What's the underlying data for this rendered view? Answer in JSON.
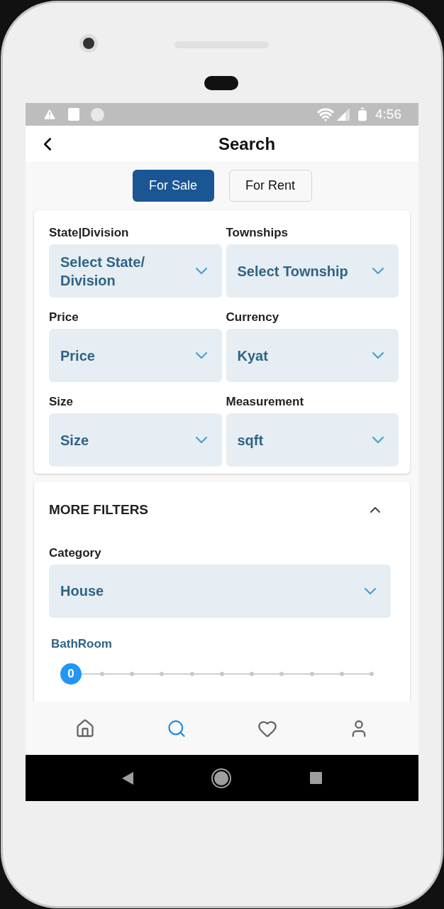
{
  "status_bar": {
    "time": "4:56"
  },
  "header": {
    "title": "Search"
  },
  "listing_tabs": [
    {
      "label": "For Sale",
      "selected": true
    },
    {
      "label": "For Rent",
      "selected": false
    }
  ],
  "filters": [
    {
      "label": "State|Division",
      "value": "Select State/ Division"
    },
    {
      "label": "Townships",
      "value": "Select Township"
    },
    {
      "label": "Price",
      "value": "Price"
    },
    {
      "label": "Currency",
      "value": "Kyat"
    },
    {
      "label": "Size",
      "value": "Size"
    },
    {
      "label": "Measurement",
      "value": "sqft"
    }
  ],
  "more_filters": {
    "title": "MORE FILTERS",
    "expanded": true,
    "category": {
      "label": "Category",
      "value": "House"
    },
    "sliders": [
      {
        "label": "BathRoom",
        "level": 0,
        "reading": "0"
      }
    ]
  },
  "bottom_nav": [
    {
      "kind": "home",
      "selected": false
    },
    {
      "kind": "search",
      "selected": true
    },
    {
      "kind": "favorites",
      "selected": false
    },
    {
      "kind": "profile",
      "selected": false
    }
  ]
}
